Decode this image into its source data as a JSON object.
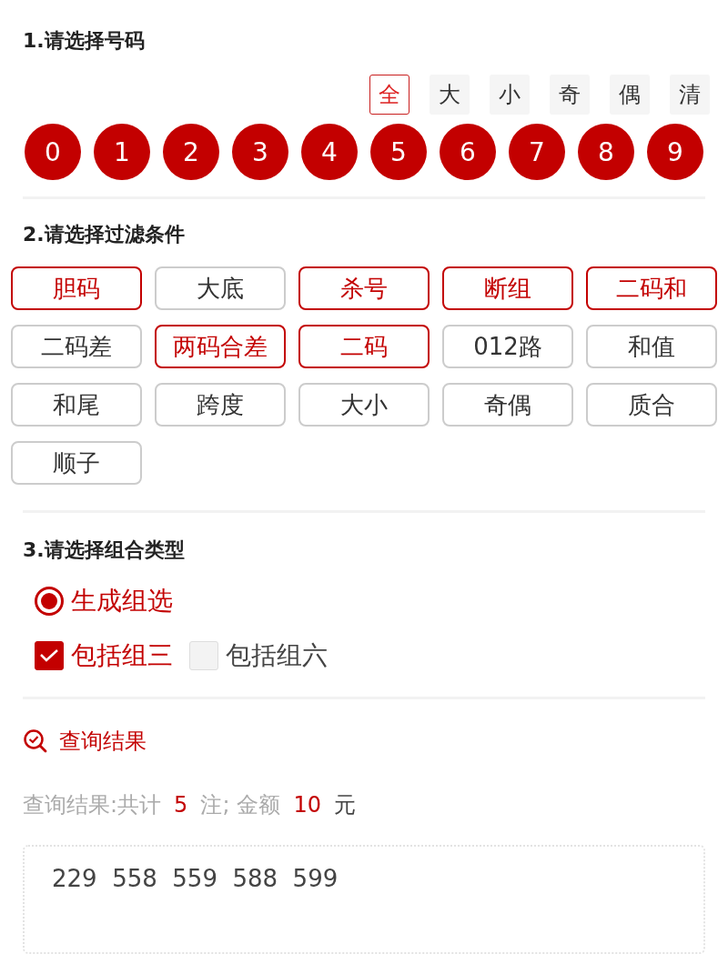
{
  "section_1": {
    "title": "1.请选择号码",
    "quick_picks": [
      {
        "label": "全",
        "selected": true
      },
      {
        "label": "大",
        "selected": false
      },
      {
        "label": "小",
        "selected": false
      },
      {
        "label": "奇",
        "selected": false
      },
      {
        "label": "偶",
        "selected": false
      },
      {
        "label": "清",
        "selected": false
      }
    ],
    "numbers": [
      {
        "label": "0",
        "selected": true
      },
      {
        "label": "1",
        "selected": true
      },
      {
        "label": "2",
        "selected": true
      },
      {
        "label": "3",
        "selected": true
      },
      {
        "label": "4",
        "selected": true
      },
      {
        "label": "5",
        "selected": true
      },
      {
        "label": "6",
        "selected": true
      },
      {
        "label": "7",
        "selected": true
      },
      {
        "label": "8",
        "selected": true
      },
      {
        "label": "9",
        "selected": true
      }
    ]
  },
  "section_2": {
    "title": "2.请选择过滤条件",
    "filters": [
      {
        "label": "胆码",
        "selected": true
      },
      {
        "label": "大底",
        "selected": false
      },
      {
        "label": "杀号",
        "selected": true
      },
      {
        "label": "断组",
        "selected": true
      },
      {
        "label": "二码和",
        "selected": true
      },
      {
        "label": "二码差",
        "selected": false
      },
      {
        "label": "两码合差",
        "selected": true
      },
      {
        "label": "二码",
        "selected": true
      },
      {
        "label": "012路",
        "selected": false
      },
      {
        "label": "和值",
        "selected": false
      },
      {
        "label": "和尾",
        "selected": false
      },
      {
        "label": "跨度",
        "selected": false
      },
      {
        "label": "大小",
        "selected": false
      },
      {
        "label": "奇偶",
        "selected": false
      },
      {
        "label": "质合",
        "selected": false
      },
      {
        "label": "顺子",
        "selected": false
      }
    ]
  },
  "section_3": {
    "title": "3.请选择组合类型",
    "radio": {
      "label": "生成组选",
      "selected": true
    },
    "checkboxes": [
      {
        "label": "包括组三",
        "checked": true
      },
      {
        "label": "包括组六",
        "checked": false
      }
    ]
  },
  "results": {
    "title": "查询结果",
    "summary": {
      "prefix": "查询结果:共计",
      "count": "5",
      "unit": "注;",
      "amount_label": "金额",
      "amount": "10",
      "currency": "元"
    },
    "numbers": "229  558  559  588  599"
  }
}
